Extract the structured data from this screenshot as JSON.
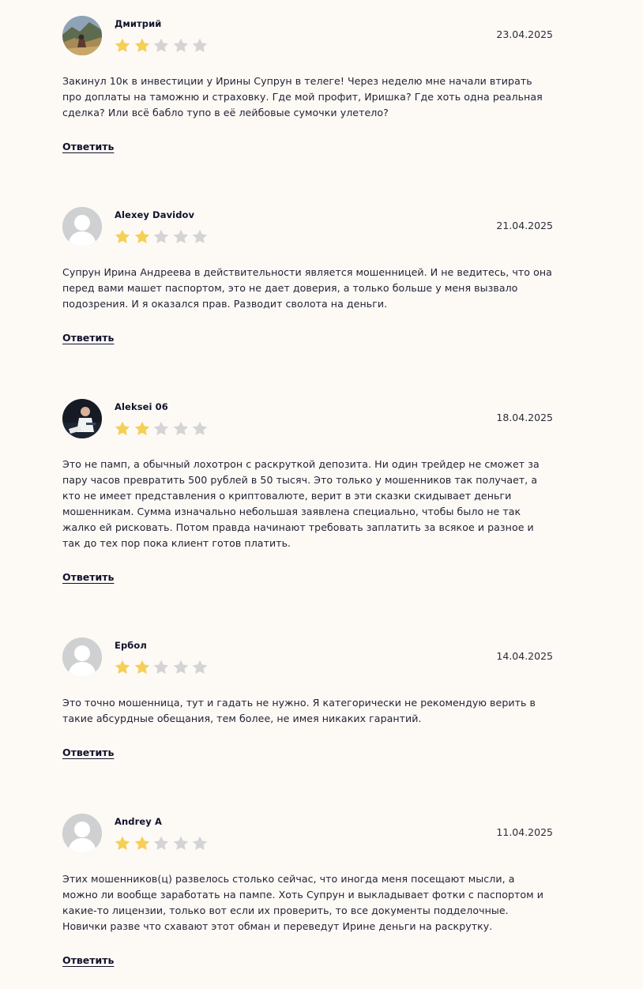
{
  "reviews": [
    {
      "author": "Дмитрий",
      "date": "23.04.2025",
      "rating": 2,
      "max_rating": 5,
      "avatar": "photo-mountain",
      "text": "Закинул 10к в инвестиции у Ирины Супрун в телеге! Через неделю мне начали втирать про доплаты на таможню и страховку. Где мой профит, Иришка? Где хоть одна реальная сделка? Или всё бабло тупо в её лейбовые сумочки улетело?",
      "reply_label": "Ответить"
    },
    {
      "author": "Alexey Davidov",
      "date": "21.04.2025",
      "rating": 2,
      "max_rating": 5,
      "avatar": "default-user",
      "text": "Супрун Ирина Андреева в действительности является мошенницей. И не ведитесь, что она перед вами машет паспортом, это не дает доверия, а только больше у меня вызвало подозрения. И я оказался прав. Разводит сволота на деньги.",
      "reply_label": "Ответить"
    },
    {
      "author": "Aleksei 06",
      "date": "18.04.2025",
      "rating": 2,
      "max_rating": 5,
      "avatar": "photo-person",
      "text": "Это не памп, а обычный лохотрон с раскруткой депозита. Ни один трейдер не сможет за пару часов превратить 500 рублей в 50 тысяч. Это только у мошенников так получает, а кто не имеет представления о криптовалюте, верит в эти сказки скидывает деньги мошенникам. Сумма изначально небольшая заявлена специально, чтобы было не так жалко ей рисковать. Потом правда начинают требовать заплатить за всякое и разное и так до тех пор пока клиент готов платить.",
      "reply_label": "Ответить"
    },
    {
      "author": "Ербол",
      "date": "14.04.2025",
      "rating": 2,
      "max_rating": 5,
      "avatar": "default-user",
      "text": "Это точно мошенница, тут и гадать не нужно. Я категорически не рекомендую верить в такие абсурдные обещания, тем более, не имея никаких гарантий.",
      "reply_label": "Ответить"
    },
    {
      "author": "Andrey A",
      "date": "11.04.2025",
      "rating": 2,
      "max_rating": 5,
      "avatar": "default-user",
      "text": "Этих мошенников(ц) развелось столько сейчас, что иногда меня посещают мысли, а можно ли вообще заработать на пампе. Хоть Супрун и выкладывает фотки с паспортом и какие-то лицензии, только вот если их проверить, то все документы подделочные. Новички разве что схавают этот обман и переведут Ирине деньги на раскрутку.",
      "reply_label": "Ответить"
    }
  ],
  "colors": {
    "background": "#fdfaf6",
    "star_filled": "#f6cf55",
    "star_empty": "#d4d4d4",
    "text": "#232334"
  }
}
